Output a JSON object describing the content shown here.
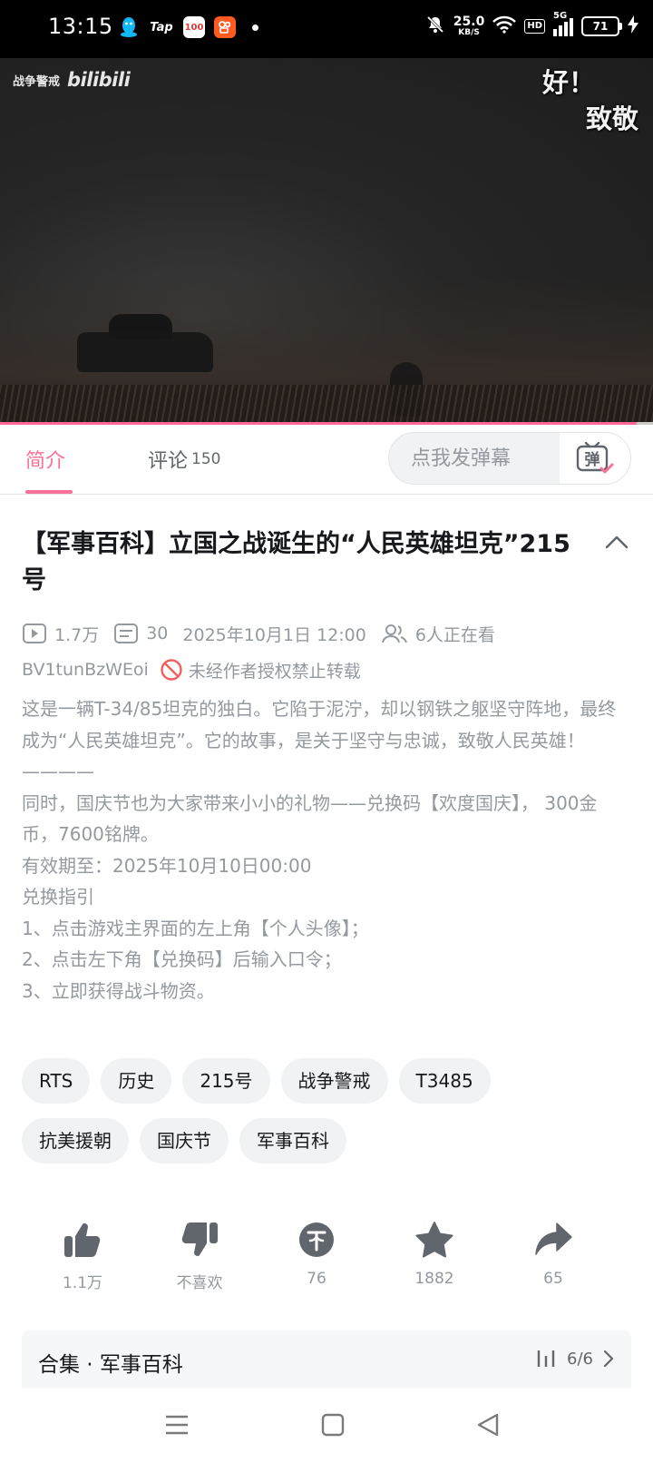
{
  "status_bar": {
    "time": "13:15",
    "app_icons": [
      "qq-icon",
      "taptap-icon",
      "100-app-icon",
      "kuaishou-icon"
    ],
    "taptap_label": "Tap",
    "app100_label": "100",
    "net_speed": "25.0",
    "net_unit": "KB/S",
    "hd_label": "HD",
    "network": "5G",
    "battery": "71"
  },
  "video": {
    "watermark_game": "战争警戒",
    "watermark_logo": "bilibili",
    "danmaku": [
      "好！",
      "致敬"
    ],
    "progress": 0.975,
    "colors": {
      "progress": "#ff6699"
    }
  },
  "tabs": {
    "intro": "简介",
    "comments": "评论",
    "comments_count": "150",
    "danmaku_placeholder": "点我发弹幕",
    "danmaku_button": "弹"
  },
  "video_info": {
    "title": "【军事百科】立国之战诞生的“人民英雄坦克”215号",
    "views": "1.7万",
    "danmaku_count": "30",
    "publish_time": "2025年10月1日 12:00",
    "watching": "6人正在看",
    "bvid": "BV1tunBzWEoi",
    "copyright_notice": "未经作者授权禁止转载"
  },
  "description": [
    "这是一辆T-34/85坦克的独白。它陷于泥泞，却以钢铁之躯坚守阵地，最终成为“人民英雄坦克”。它的故事，是关于坚守与忠诚，致敬人民英雄！",
    "————",
    "同时，国庆节也为大家带来小小的礼物——兑换码【欢度国庆】， 300金币，7600铭牌。",
    "有效期至：2025年10月10日00:00",
    "兑换指引",
    "1、点击游戏主界面的左上角【个人头像】；",
    "2、点击左下角【兑换码】后输入口令；",
    "3、立即获得战斗物资。"
  ],
  "tags": [
    "RTS",
    "历史",
    "215号",
    "战争警戒",
    "T3485",
    "抗美援朝",
    "国庆节",
    "军事百科"
  ],
  "actions": {
    "like": "1.1万",
    "dislike": "不喜欢",
    "coin": "76",
    "favorite": "1882",
    "share": "65"
  },
  "collection": {
    "title": "合集 · 军事百科",
    "progress": "6/6"
  },
  "colors": {
    "accent": "#fb7299",
    "text_primary": "#18191c",
    "text_secondary": "#9499a0",
    "icon_gray": "#61666d"
  }
}
